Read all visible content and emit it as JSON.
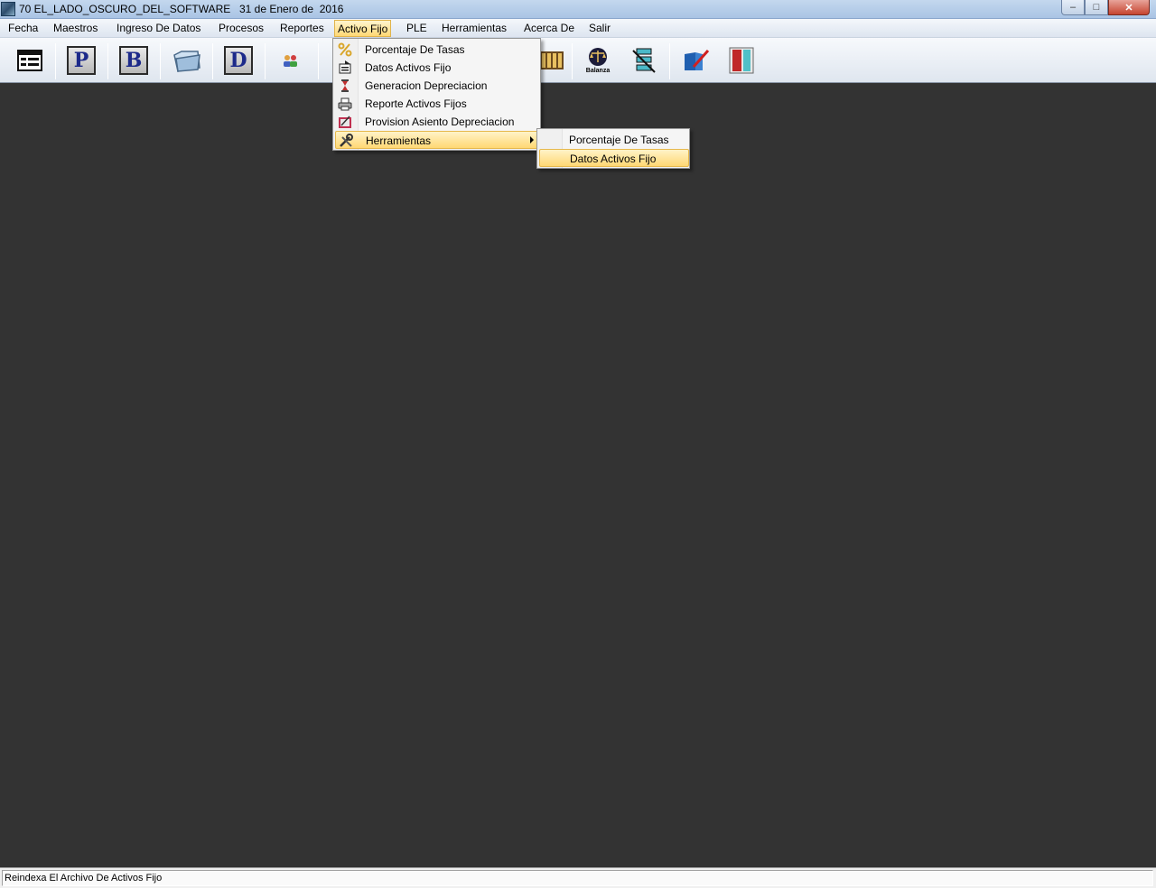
{
  "window": {
    "title": "70 EL_LADO_OSCURO_DEL_SOFTWARE",
    "date": "31 de Enero de  2016",
    "minimize": "–",
    "maximize": "□",
    "close": "✕"
  },
  "menubar": {
    "items": [
      {
        "label": "Fecha"
      },
      {
        "label": "Maestros"
      },
      {
        "label": "Ingreso De Datos"
      },
      {
        "label": "Procesos"
      },
      {
        "label": "Reportes"
      },
      {
        "label": "Activo Fijo"
      },
      {
        "label": "PLE"
      },
      {
        "label": "Herramientas"
      },
      {
        "label": "Acerca De"
      },
      {
        "label": "Salir"
      }
    ]
  },
  "toolbar": {
    "letters": {
      "p": "P",
      "b": "B",
      "d": "D"
    },
    "balanza_label": "Balanza"
  },
  "activo_fijo_menu": {
    "items": [
      {
        "label": "Porcentaje De Tasas",
        "icon": "percent-icon"
      },
      {
        "label": "Datos Activos Fijo",
        "icon": "data-form-icon"
      },
      {
        "label": "Generacion Depreciacion",
        "icon": "hourglass-icon"
      },
      {
        "label": "Reporte Activos Fijos",
        "icon": "printer-icon"
      },
      {
        "label": "Provision Asiento Depreciacion",
        "icon": "ledger-icon"
      },
      {
        "label": "Herramientas",
        "icon": "tools-icon",
        "highlighted": true,
        "submenu": true
      }
    ]
  },
  "herramientas_submenu": {
    "items": [
      {
        "label": "Porcentaje De Tasas"
      },
      {
        "label": "Datos Activos Fijo",
        "highlighted": true
      }
    ]
  },
  "statusbar": {
    "text": "Reindexa El Archivo De Activos Fijo"
  },
  "colors": {
    "workspace": "#333333",
    "highlight": "#ffd874",
    "titlebar": "#b9cfe9"
  }
}
